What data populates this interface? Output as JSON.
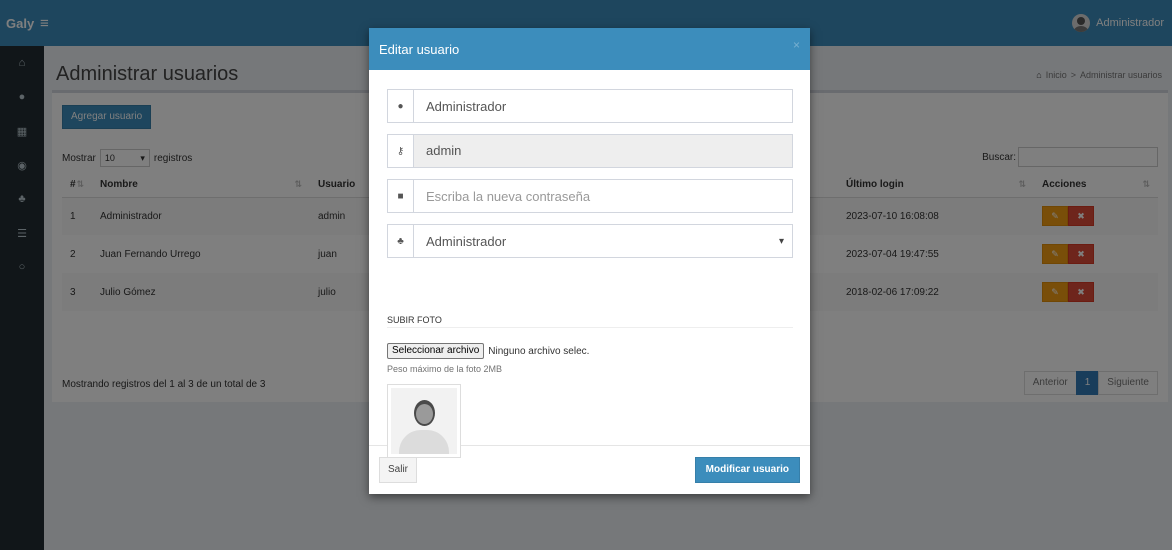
{
  "app": {
    "brand": "Galy",
    "user_name": "Administrador"
  },
  "sidebar": {
    "icons": [
      "home-icon",
      "user-icon",
      "grid-icon",
      "product-icon",
      "users-icon",
      "list-icon",
      "circle-icon"
    ]
  },
  "page": {
    "title": "Administrar usuarios",
    "breadcrumb": {
      "home": "Inicio",
      "separator": ">",
      "current": "Administrar usuarios"
    },
    "add_button": "Agregar usuario",
    "show_label": "Mostrar",
    "show_value": "10",
    "records_label": "registros",
    "search_label": "Buscar:"
  },
  "table": {
    "headers": {
      "num": "#",
      "name": "Nombre",
      "user": "Usuario",
      "last_login": "Último login",
      "actions": "Acciones"
    },
    "rows": [
      {
        "num": "1",
        "name": "Administrador",
        "user": "admin",
        "last_login": "2023-07-10 16:08:08"
      },
      {
        "num": "2",
        "name": "Juan Fernando Urrego",
        "user": "juan",
        "last_login": "2023-07-04 19:47:55"
      },
      {
        "num": "3",
        "name": "Julio Gómez",
        "user": "julio",
        "last_login": "2018-02-06 17:09:22"
      }
    ],
    "info": "Mostrando registros del 1 al 3 de un total de 3",
    "pagination": {
      "prev": "Anterior",
      "current": "1",
      "next": "Siguiente"
    }
  },
  "modal": {
    "title": "Editar usuario",
    "close": "×",
    "name_value": "Administrador",
    "username_value": "admin",
    "password_placeholder": "Escriba la nueva contraseña",
    "profile_value": "Administrador",
    "upload_title": "SUBIR FOTO",
    "file_button": "Seleccionar archivo",
    "file_status": "Ninguno archivo selec.",
    "hint": "Peso máximo de la foto 2MB",
    "exit_button": "Salir",
    "save_button": "Modificar usuario"
  },
  "colors": {
    "primary": "#3c8dbc",
    "sidebar": "#222d32",
    "warning": "#f39c12",
    "danger": "#dd4b39"
  }
}
